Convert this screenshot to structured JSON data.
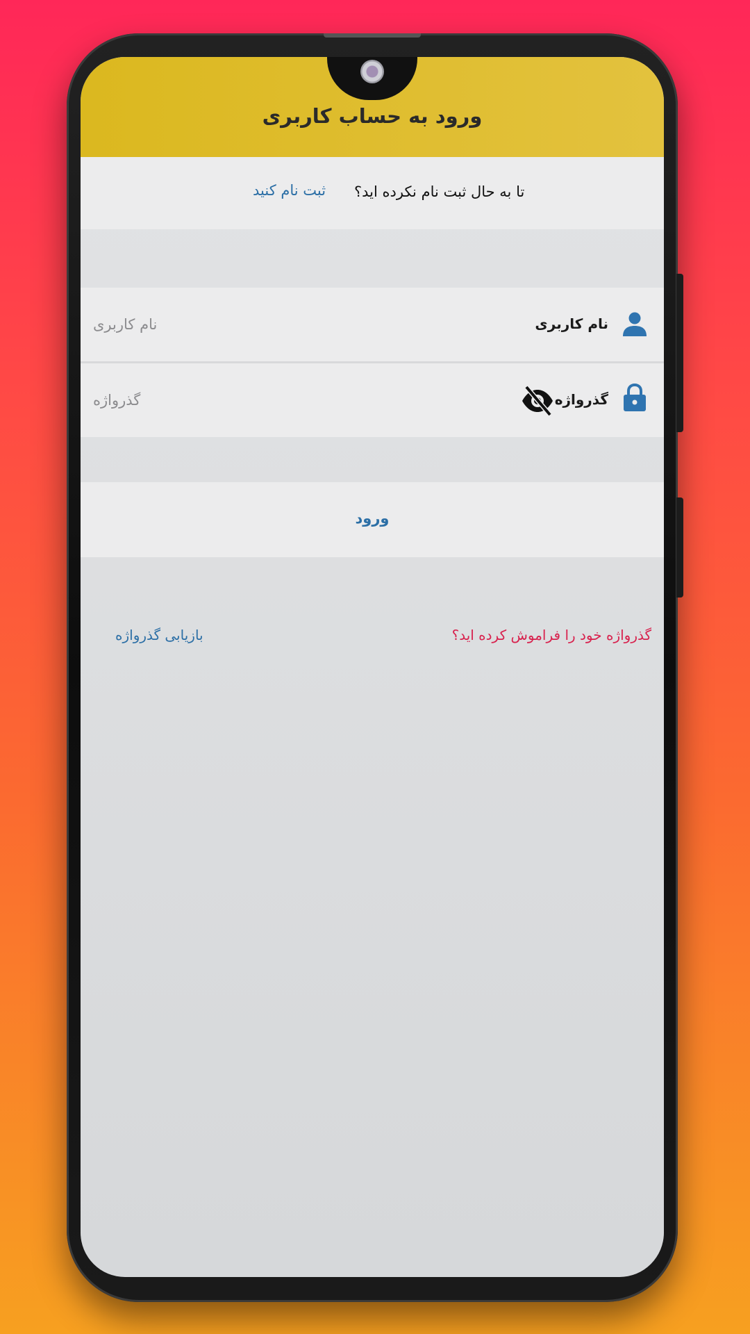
{
  "header": {
    "title": "ورود به حساب کاربری"
  },
  "register": {
    "question": "تا به حال ثبت نام نکرده اید؟",
    "link_label": "ثبت نام کنید"
  },
  "form": {
    "username": {
      "label": "نام کاربری",
      "placeholder": "نام کاربری",
      "value": "",
      "icon": "user-icon"
    },
    "password": {
      "label": "گذرواژه",
      "placeholder": "گذرواژه",
      "value": "",
      "icon": "lock-icon",
      "toggle_icon": "eye-off-icon"
    },
    "login_label": "ورود"
  },
  "footer": {
    "forgot_text": "گذرواژه خود را فراموش کرده اید؟",
    "recover_label": "بازیابی گذرواژه"
  },
  "colors": {
    "header": "#dbb81f",
    "accent_blue": "#2c6fa6",
    "accent_red": "#d8224e",
    "row_bg": "#ececed"
  }
}
